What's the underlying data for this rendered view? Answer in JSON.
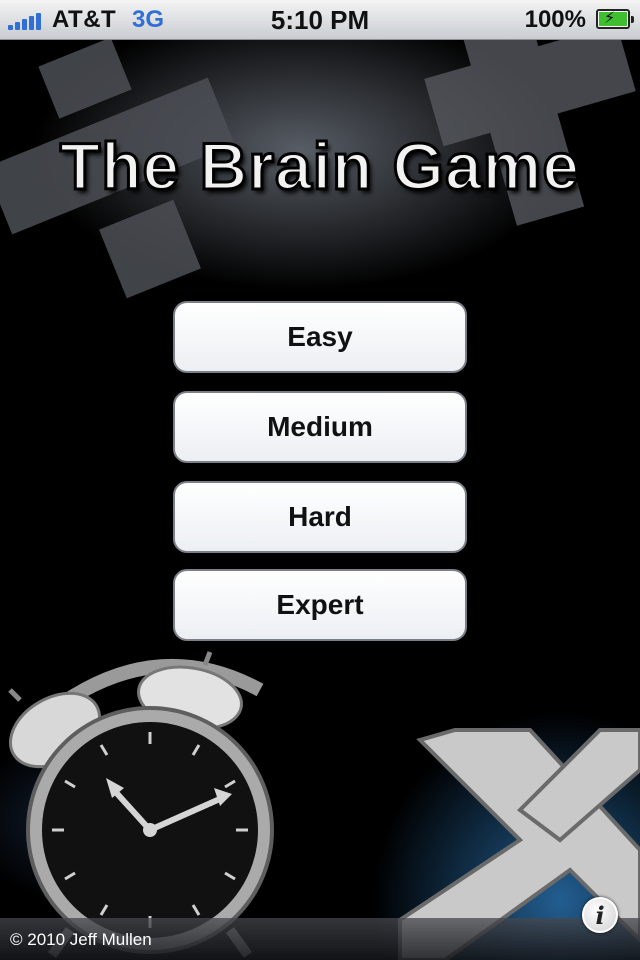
{
  "status_bar": {
    "carrier": "AT&T",
    "network": "3G",
    "time": "5:10 PM",
    "battery_percent": "100%",
    "battery_level": 1.0,
    "signal_bars": 5,
    "accent_color": "#2f6fd6"
  },
  "title": "The Brain Game",
  "menu": {
    "easy": "Easy",
    "medium": "Medium",
    "hard": "Hard",
    "expert": "Expert"
  },
  "footer": {
    "copyright": "© 2010 Jeff Mullen",
    "info_icon": "i"
  },
  "icons": [
    "signal-icon",
    "battery-icon",
    "alarm-clock-icon",
    "multiply-sign-icon",
    "info-icon"
  ]
}
